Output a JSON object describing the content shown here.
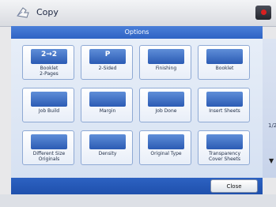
{
  "titlebar": {
    "title": "Copy"
  },
  "panel": {
    "header": "Options"
  },
  "tiles": [
    {
      "label": "Booklet\n2-Pages",
      "thumb_text": "2→2"
    },
    {
      "label": "2-Sided",
      "thumb_text": "P"
    },
    {
      "label": "Finishing",
      "thumb_text": ""
    },
    {
      "label": "Booklet",
      "thumb_text": ""
    },
    {
      "label": "Job Build",
      "thumb_text": ""
    },
    {
      "label": "Margin",
      "thumb_text": ""
    },
    {
      "label": "Job Done",
      "thumb_text": ""
    },
    {
      "label": "Insert Sheets",
      "thumb_text": ""
    },
    {
      "label": "Different Size\nOriginals",
      "thumb_text": ""
    },
    {
      "label": "Density",
      "thumb_text": ""
    },
    {
      "label": "Original Type",
      "thumb_text": ""
    },
    {
      "label": "Transparency\nCover Sheets",
      "thumb_text": ""
    }
  ],
  "side": {
    "tick": "1/2",
    "arrow": "▼"
  },
  "buttons": {
    "close": "Close"
  }
}
